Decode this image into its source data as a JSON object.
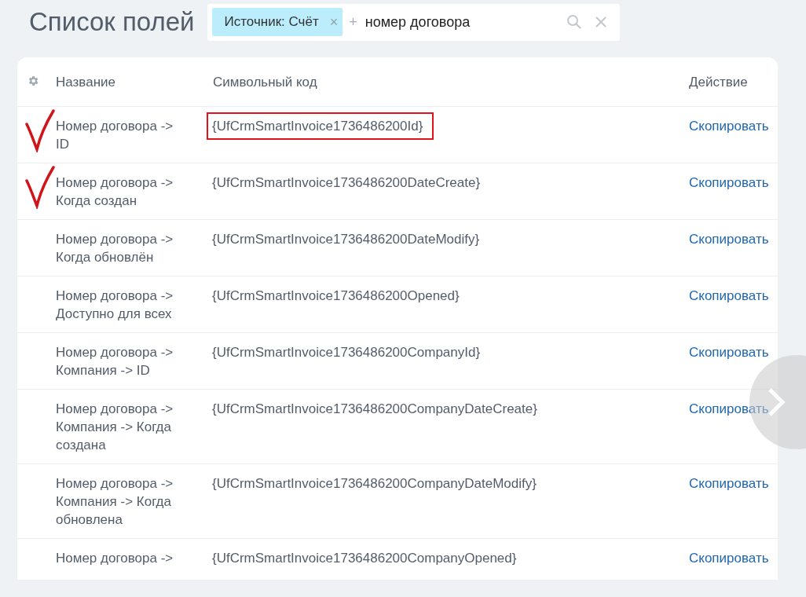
{
  "page_title": "Список полей",
  "filter": {
    "tags": [
      {
        "label": "Источник: Счёт",
        "remove": "×"
      }
    ],
    "add": "+",
    "value": "номер договора"
  },
  "table": {
    "columns": [
      "Название",
      "Символьный код",
      "Действие"
    ],
    "rows": [
      {
        "name": [
          "Номер договора ->",
          "ID"
        ],
        "code": "{UfCrmSmartInvoice1736486200Id}",
        "action": "Скопировать",
        "checkmark": true,
        "highlighted": true
      },
      {
        "name": [
          "Номер договора ->",
          "Когда создан"
        ],
        "code": "{UfCrmSmartInvoice1736486200DateCreate}",
        "action": "Скопировать",
        "checkmark": true,
        "highlighted": false
      },
      {
        "name": [
          "Номер договора ->",
          "Когда обновлён"
        ],
        "code": "{UfCrmSmartInvoice1736486200DateModify}",
        "action": "Скопировать",
        "checkmark": false,
        "highlighted": false
      },
      {
        "name": [
          "Номер договора ->",
          "Доступно для всех"
        ],
        "code": "{UfCrmSmartInvoice1736486200Opened}",
        "action": "Скопировать",
        "checkmark": false,
        "highlighted": false
      },
      {
        "name": [
          "Номер договора ->",
          "Компания -> ID"
        ],
        "code": "{UfCrmSmartInvoice1736486200CompanyId}",
        "action": "Скопировать",
        "checkmark": false,
        "highlighted": false
      },
      {
        "name": [
          "Номер договора ->",
          "Компания -> Когда",
          "создана"
        ],
        "code": "{UfCrmSmartInvoice1736486200CompanyDateCreate}",
        "action": "Скопировать",
        "checkmark": false,
        "highlighted": false
      },
      {
        "name": [
          "Номер договора ->",
          "Компания -> Когда",
          "обновлена"
        ],
        "code": "{UfCrmSmartInvoice1736486200CompanyDateModify}",
        "action": "Скопировать",
        "checkmark": false,
        "highlighted": false
      },
      {
        "name": [
          "Номер договора ->"
        ],
        "code": "{UfCrmSmartInvoice1736486200CompanyOpened}",
        "action": "Скопировать",
        "checkmark": false,
        "highlighted": false
      }
    ]
  }
}
